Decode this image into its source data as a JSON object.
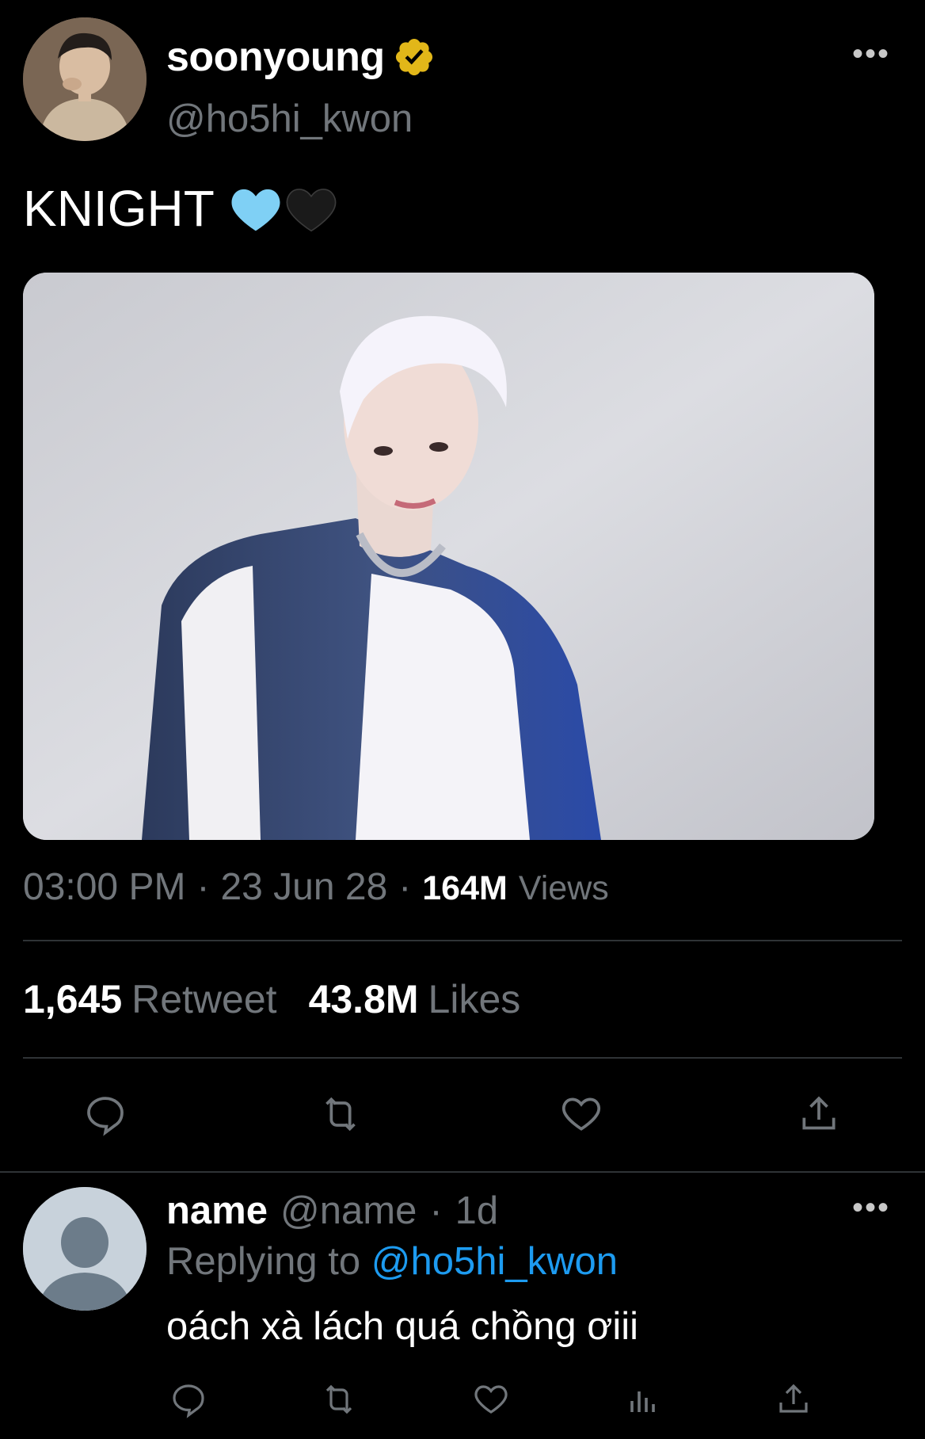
{
  "tweet": {
    "author": {
      "display_name": "soonyoung",
      "handle": "@ho5hi_kwon",
      "verified": true,
      "verified_color": "#e2b719"
    },
    "text": "KNIGHT",
    "emoji": [
      "🩵",
      "🖤"
    ],
    "time": "03:00 PM",
    "separator": "·",
    "date": "23 Jun 28",
    "views_count": "164M",
    "views_label": "Views",
    "retweets_count": "1,645",
    "retweets_label": "Retweet",
    "likes_count": "43.8M",
    "likes_label": "Likes",
    "more_icon": "more-icon"
  },
  "actions": [
    {
      "name": "reply-icon"
    },
    {
      "name": "retweet-icon"
    },
    {
      "name": "like-icon"
    },
    {
      "name": "share-icon"
    }
  ],
  "reply": {
    "display_name": "name",
    "handle": "@name",
    "separator": "·",
    "age": "1d",
    "replying_label": "Replying to",
    "replying_to": "@ho5hi_kwon",
    "text": "oách xà lách quá chồng ơiii",
    "actions": [
      "reply-icon",
      "retweet-icon",
      "like-icon",
      "views-icon",
      "share-icon"
    ]
  },
  "colors": {
    "background": "#000000",
    "text_primary": "#ffffff",
    "text_secondary": "#71767b",
    "link": "#1d9bf0",
    "divider": "#2f3336"
  }
}
